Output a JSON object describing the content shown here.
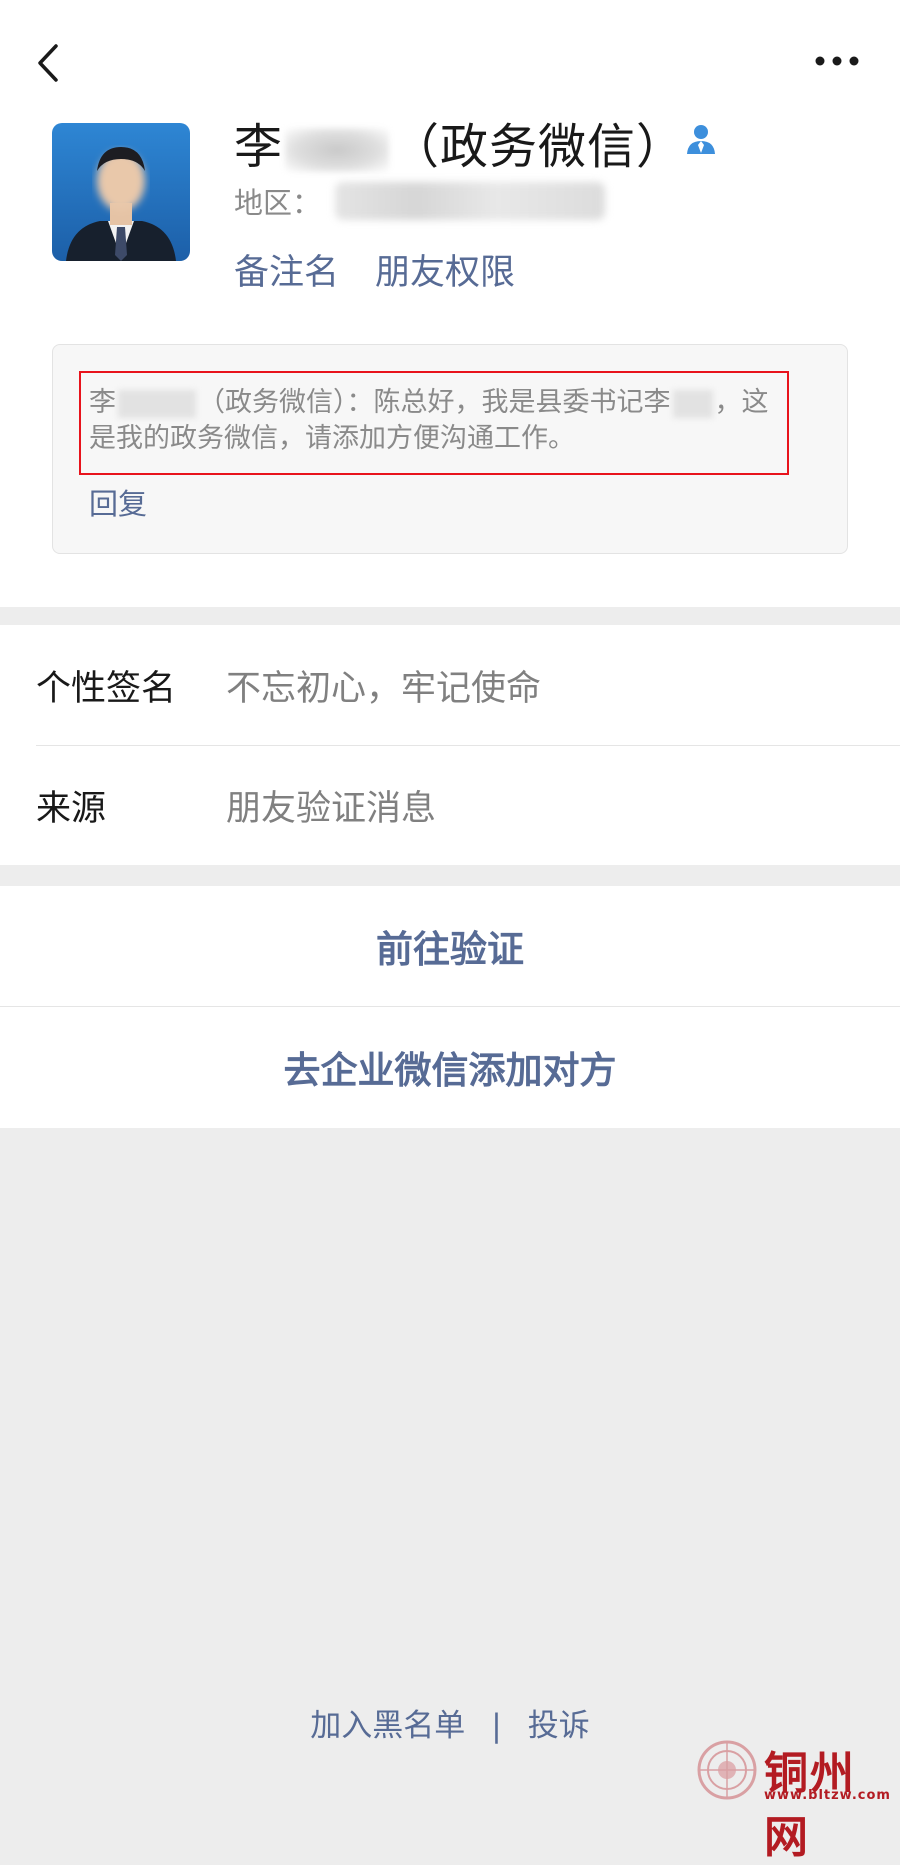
{
  "header": {
    "back_icon": "chevron-left-icon",
    "more_icon": "more-dots-icon"
  },
  "profile": {
    "name_prefix": "李",
    "name_suffix": "（政务微信）",
    "contact_icon": "person-badge-icon",
    "region_label": "地区：",
    "remark_action": "备注名",
    "permission_action": "朋友权限"
  },
  "message": {
    "part1": "李",
    "part2": "（政务微信）：陈总好，我是县委书记李",
    "part3": "，这是我的政务微信，请添加方便沟通工作。",
    "reply_label": "回复"
  },
  "info": {
    "rows": [
      {
        "label": "个性签名",
        "value": "不忘初心，牢记使命"
      },
      {
        "label": "来源",
        "value": "朋友验证消息"
      }
    ]
  },
  "buttons": {
    "verify": "前往验证",
    "enterprise_add": "去企业微信添加对方"
  },
  "footer": {
    "blacklist": "加入黑名单",
    "separator": "|",
    "complain": "投诉"
  },
  "watermark": {
    "site_name": "铜州网",
    "url": "www.bltzw.com"
  },
  "colors": {
    "link": "#576b95",
    "highlight_border": "#e8131c",
    "watermark": "#b31b22"
  }
}
